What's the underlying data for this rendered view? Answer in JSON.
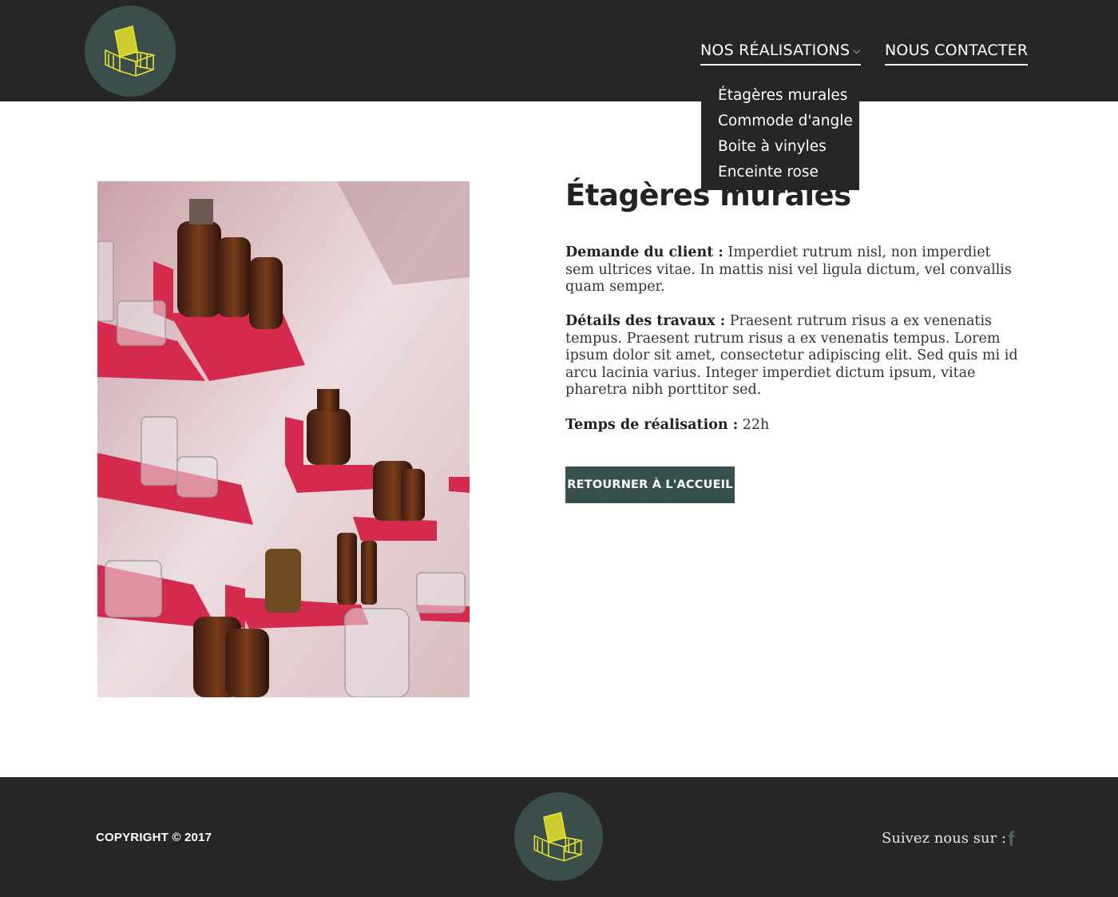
{
  "nav": {
    "realisations_label": "NOS RÉALISATIONS",
    "realisations_chevron": "⌵",
    "contact_label": "NOUS CONTACTER",
    "dropdown": [
      "Étagères murales",
      "Commode d'angle",
      "Boite à vinyles",
      "Enceinte rose"
    ]
  },
  "article": {
    "title": "Étagères murales",
    "client_label": "Demande du client :",
    "client_text": " Imperdiet rutrum nisl, non imperdiet sem ultrices vitae. In mattis nisi vel ligula dictum, vel convallis quam semper.",
    "details_label": "Détails des travaux :",
    "details_text": " Praesent rutrum risus a ex venenatis tempus. Praesent rutrum risus a ex venenatis tempus. Lorem ipsum dolor sit amet, consectetur adipiscing elit. Sed quis mi id arcu lacinia varius. Integer imperdiet dictum ipsum, vitae pharetra nibh porttitor sed.",
    "time_label": "Temps de réalisation :",
    "time_text": " 22h",
    "back_button": "RETOURNER À L'ACCUEIL"
  },
  "footer": {
    "copyright": "COPYRIGHT © 2017",
    "follow_label": "Suivez nous sur :",
    "facebook_glyph": "f"
  },
  "colors": {
    "header_bg": "#262626",
    "accent": "#37504e",
    "logo_bg": "#3a4f4c",
    "logo_chair": "#e8e32a",
    "shelf_red": "#d42a4e"
  },
  "icons": {
    "logo": "chair-logo-icon",
    "chevron": "chevron-down-icon",
    "facebook": "facebook-icon"
  }
}
